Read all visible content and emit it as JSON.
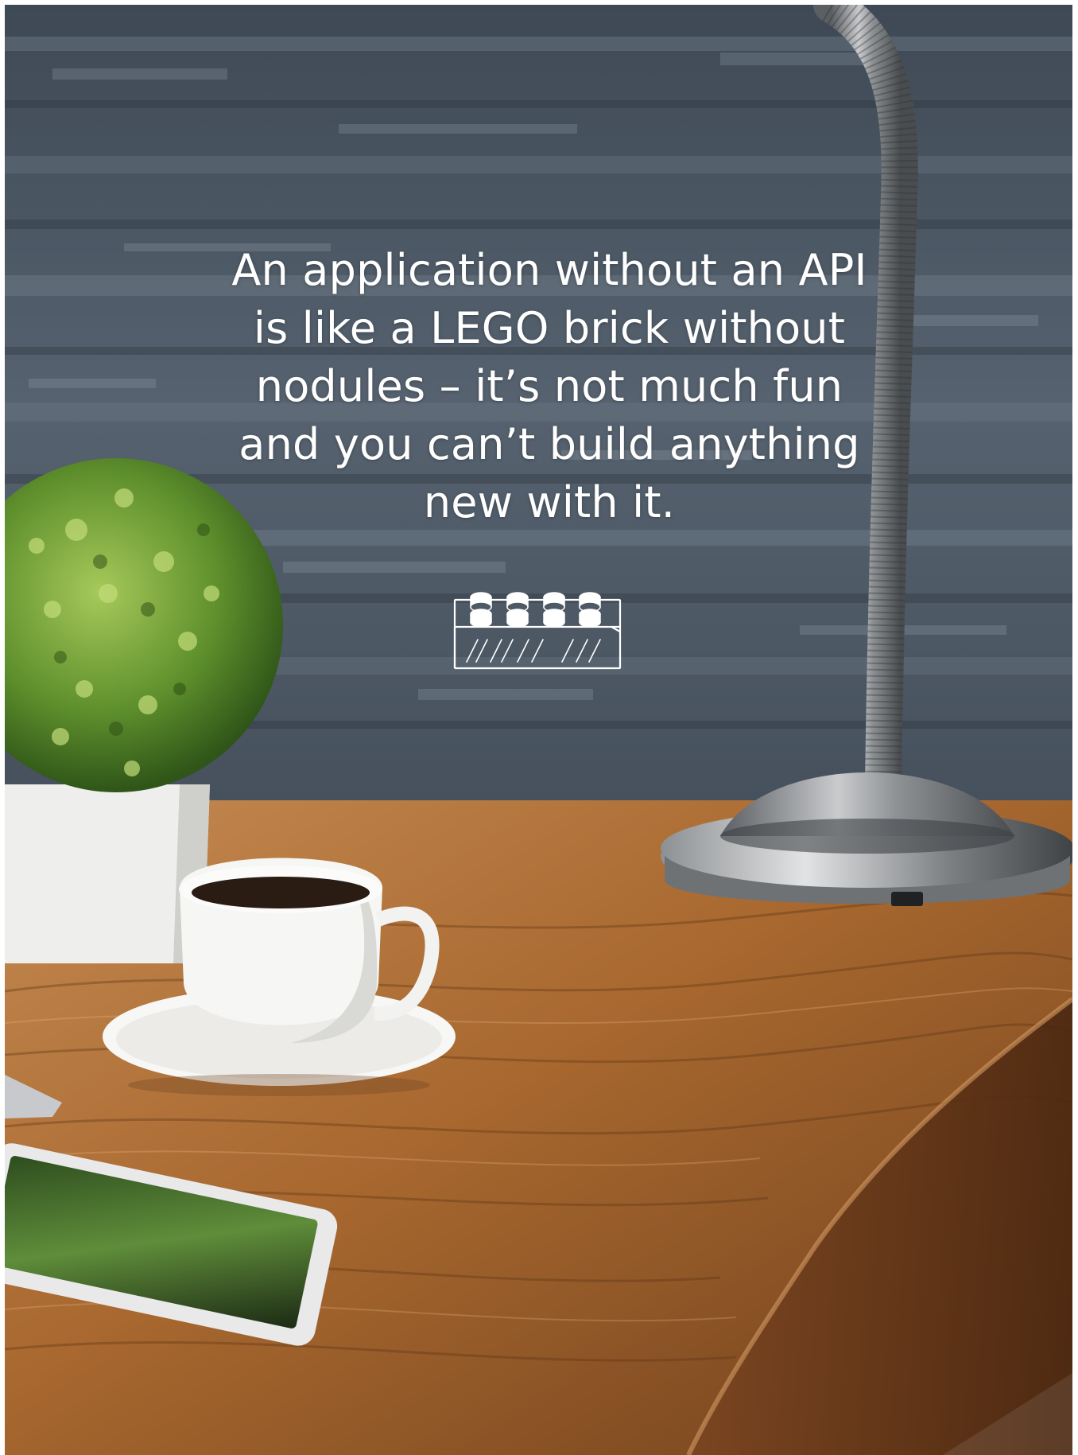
{
  "quote": {
    "lines": [
      "An application without an API",
      "is like a LEGO brick without",
      "nodules – it’s not much fun",
      "and you can’t build anything",
      "new with it."
    ]
  },
  "icons": {
    "brick": "lego-brick-icon"
  },
  "colors": {
    "text": "#ffffff",
    "wall": "#4a5663",
    "desk": "#a86a36",
    "plant": "#5e8f2c"
  }
}
